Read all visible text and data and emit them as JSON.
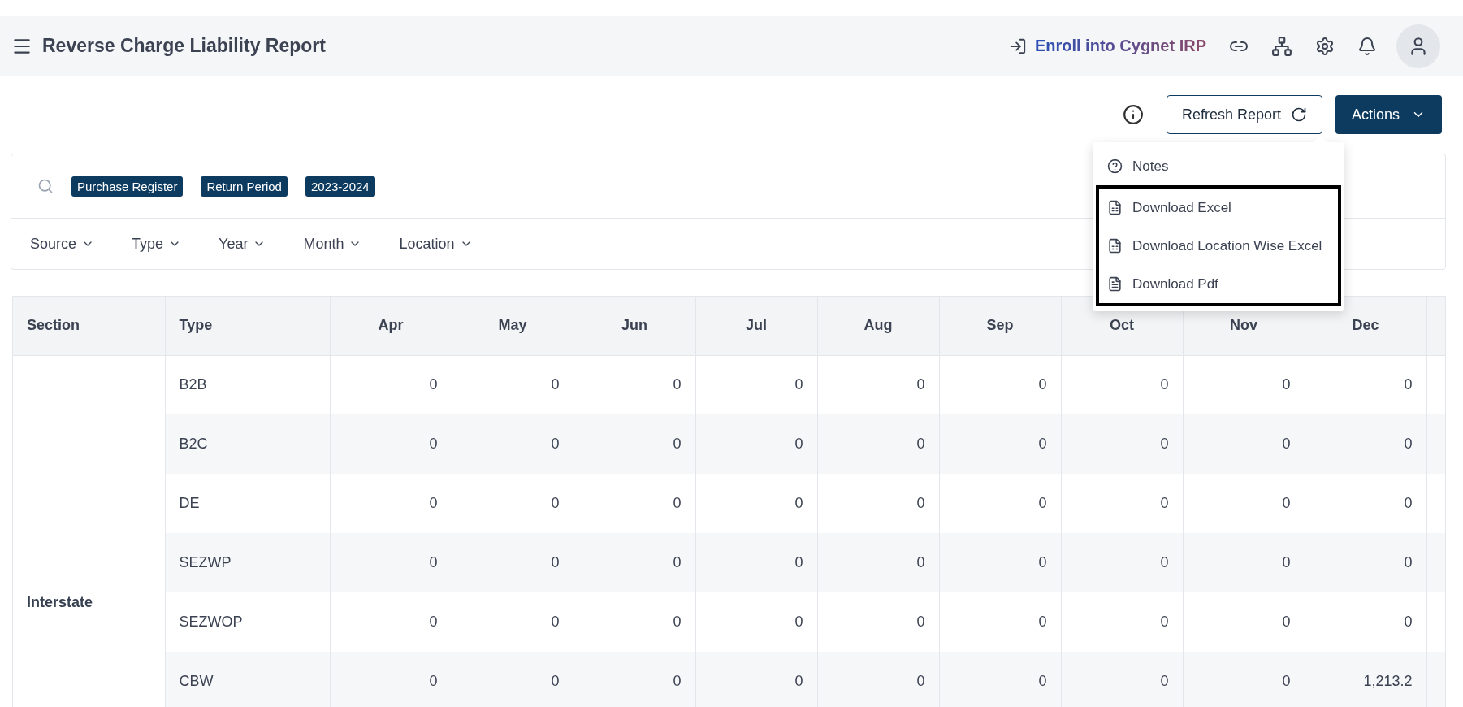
{
  "header": {
    "title": "Reverse Charge Liability Report",
    "enroll_link": "Enroll into Cygnet IRP"
  },
  "toolbar": {
    "refresh_button": "Refresh Report",
    "actions_button": "Actions"
  },
  "actions_menu": {
    "items": [
      {
        "label": "Notes",
        "kind": "help"
      }
    ],
    "highlighted_items": [
      {
        "label": "Download Excel",
        "kind": "sheet"
      },
      {
        "label": "Download Location Wise Excel",
        "kind": "sheet"
      },
      {
        "label": "Download Pdf",
        "kind": "pdf"
      }
    ]
  },
  "filters": {
    "chips": [
      "Purchase Register",
      "Return Period",
      "2023-2024"
    ],
    "dropdowns": [
      "Source",
      "Type",
      "Year",
      "Month",
      "Location"
    ]
  },
  "table": {
    "columns": [
      "Section",
      "Type",
      "Apr",
      "May",
      "Jun",
      "Jul",
      "Aug",
      "Sep",
      "Oct",
      "Nov",
      "Dec"
    ],
    "section": "Interstate",
    "rows": [
      {
        "type": "B2B",
        "values": [
          "0",
          "0",
          "0",
          "0",
          "0",
          "0",
          "0",
          "0",
          "0"
        ]
      },
      {
        "type": "B2C",
        "values": [
          "0",
          "0",
          "0",
          "0",
          "0",
          "0",
          "0",
          "0",
          "0"
        ]
      },
      {
        "type": "DE",
        "values": [
          "0",
          "0",
          "0",
          "0",
          "0",
          "0",
          "0",
          "0",
          "0"
        ]
      },
      {
        "type": "SEZWP",
        "values": [
          "0",
          "0",
          "0",
          "0",
          "0",
          "0",
          "0",
          "0",
          "0"
        ]
      },
      {
        "type": "SEZWOP",
        "values": [
          "0",
          "0",
          "0",
          "0",
          "0",
          "0",
          "0",
          "0",
          "0"
        ]
      },
      {
        "type": "CBW",
        "values": [
          "0",
          "0",
          "0",
          "0",
          "0",
          "0",
          "0",
          "0",
          "1,213.2"
        ]
      }
    ]
  }
}
